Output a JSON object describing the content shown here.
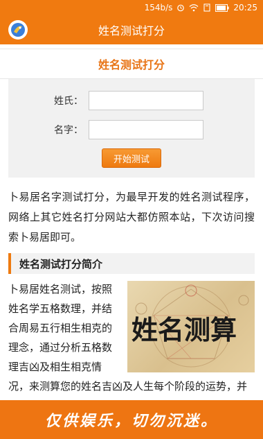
{
  "status_bar": {
    "speed": "154b/s",
    "time": "20:25"
  },
  "app_bar": {
    "title": "姓名测试打分"
  },
  "card": {
    "title": "姓名测试打分"
  },
  "form": {
    "surname_label": "姓氏：",
    "surname_value": "",
    "name_label": "名字：",
    "name_value": "",
    "start_button": "开始测试"
  },
  "intro": {
    "text": "卜易居名字测试打分，为最早开发的姓名测试程序，网络上其它姓名打分网站大都仿照本站，下次访问搜索卜易居即可。"
  },
  "section": {
    "heading": "姓名测试打分简介"
  },
  "article": {
    "text": "卜易居姓名测试，按照姓名学五格数理，并结合周易五行相生相克的理念，通过分析五格数理吉凶及相生相克情况，来测算您的姓名吉凶及人生每个阶段的运势，并解析姓名的三才运，最后得出您的姓名评分。您既可以",
    "image_caption": "姓名测算"
  },
  "banner": {
    "text": "仅供娱乐，切勿沉迷。"
  },
  "colors": {
    "accent": "#f07a10",
    "title_orange": "#e87416"
  }
}
